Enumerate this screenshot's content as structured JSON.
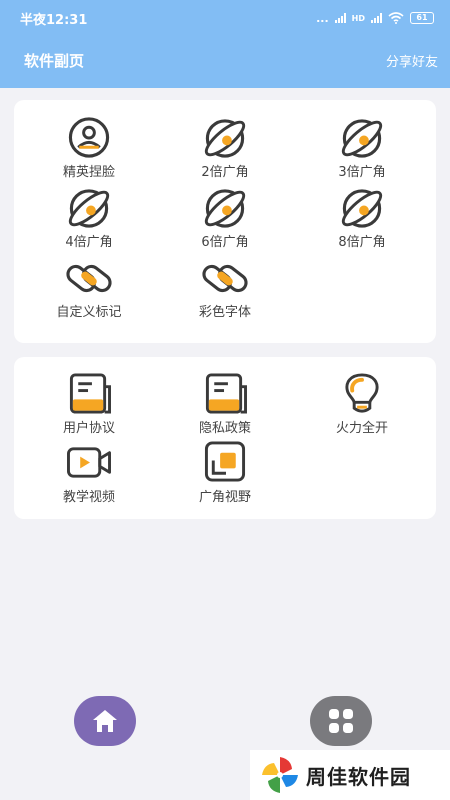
{
  "status_bar": {
    "time": "半夜12:31",
    "dots": "...",
    "signal_label": "HD",
    "battery": "61"
  },
  "header": {
    "title": "软件副页",
    "share": "分享好友"
  },
  "features": [
    {
      "label": "精英捏脸",
      "icon": "face-icon"
    },
    {
      "label": "2倍广角",
      "icon": "wide-angle-icon"
    },
    {
      "label": "3倍广角",
      "icon": "wide-angle-icon"
    },
    {
      "label": "4倍广角",
      "icon": "wide-angle-icon"
    },
    {
      "label": "6倍广角",
      "icon": "wide-angle-icon"
    },
    {
      "label": "8倍广角",
      "icon": "wide-angle-icon"
    },
    {
      "label": "自定义标记",
      "icon": "link-icon"
    },
    {
      "label": "彩色字体",
      "icon": "link-icon"
    }
  ],
  "more": [
    {
      "label": "用户协议",
      "icon": "document-icon"
    },
    {
      "label": "隐私政策",
      "icon": "document-icon"
    },
    {
      "label": "火力全开",
      "icon": "bulb-icon"
    },
    {
      "label": "教学视频",
      "icon": "video-icon"
    },
    {
      "label": "广角视野",
      "icon": "frame-icon"
    }
  ],
  "bottom_nav": [
    {
      "icon": "home-icon"
    },
    {
      "icon": "apps-grid-icon"
    }
  ],
  "watermark": {
    "text": "周佳软件园"
  },
  "colors": {
    "header": "#82bdf4",
    "accent_orange": "#f5a623",
    "icon_stroke": "#3a3a3a",
    "home_button": "#7e6ab4",
    "apps_button": "#7a7a7e"
  }
}
